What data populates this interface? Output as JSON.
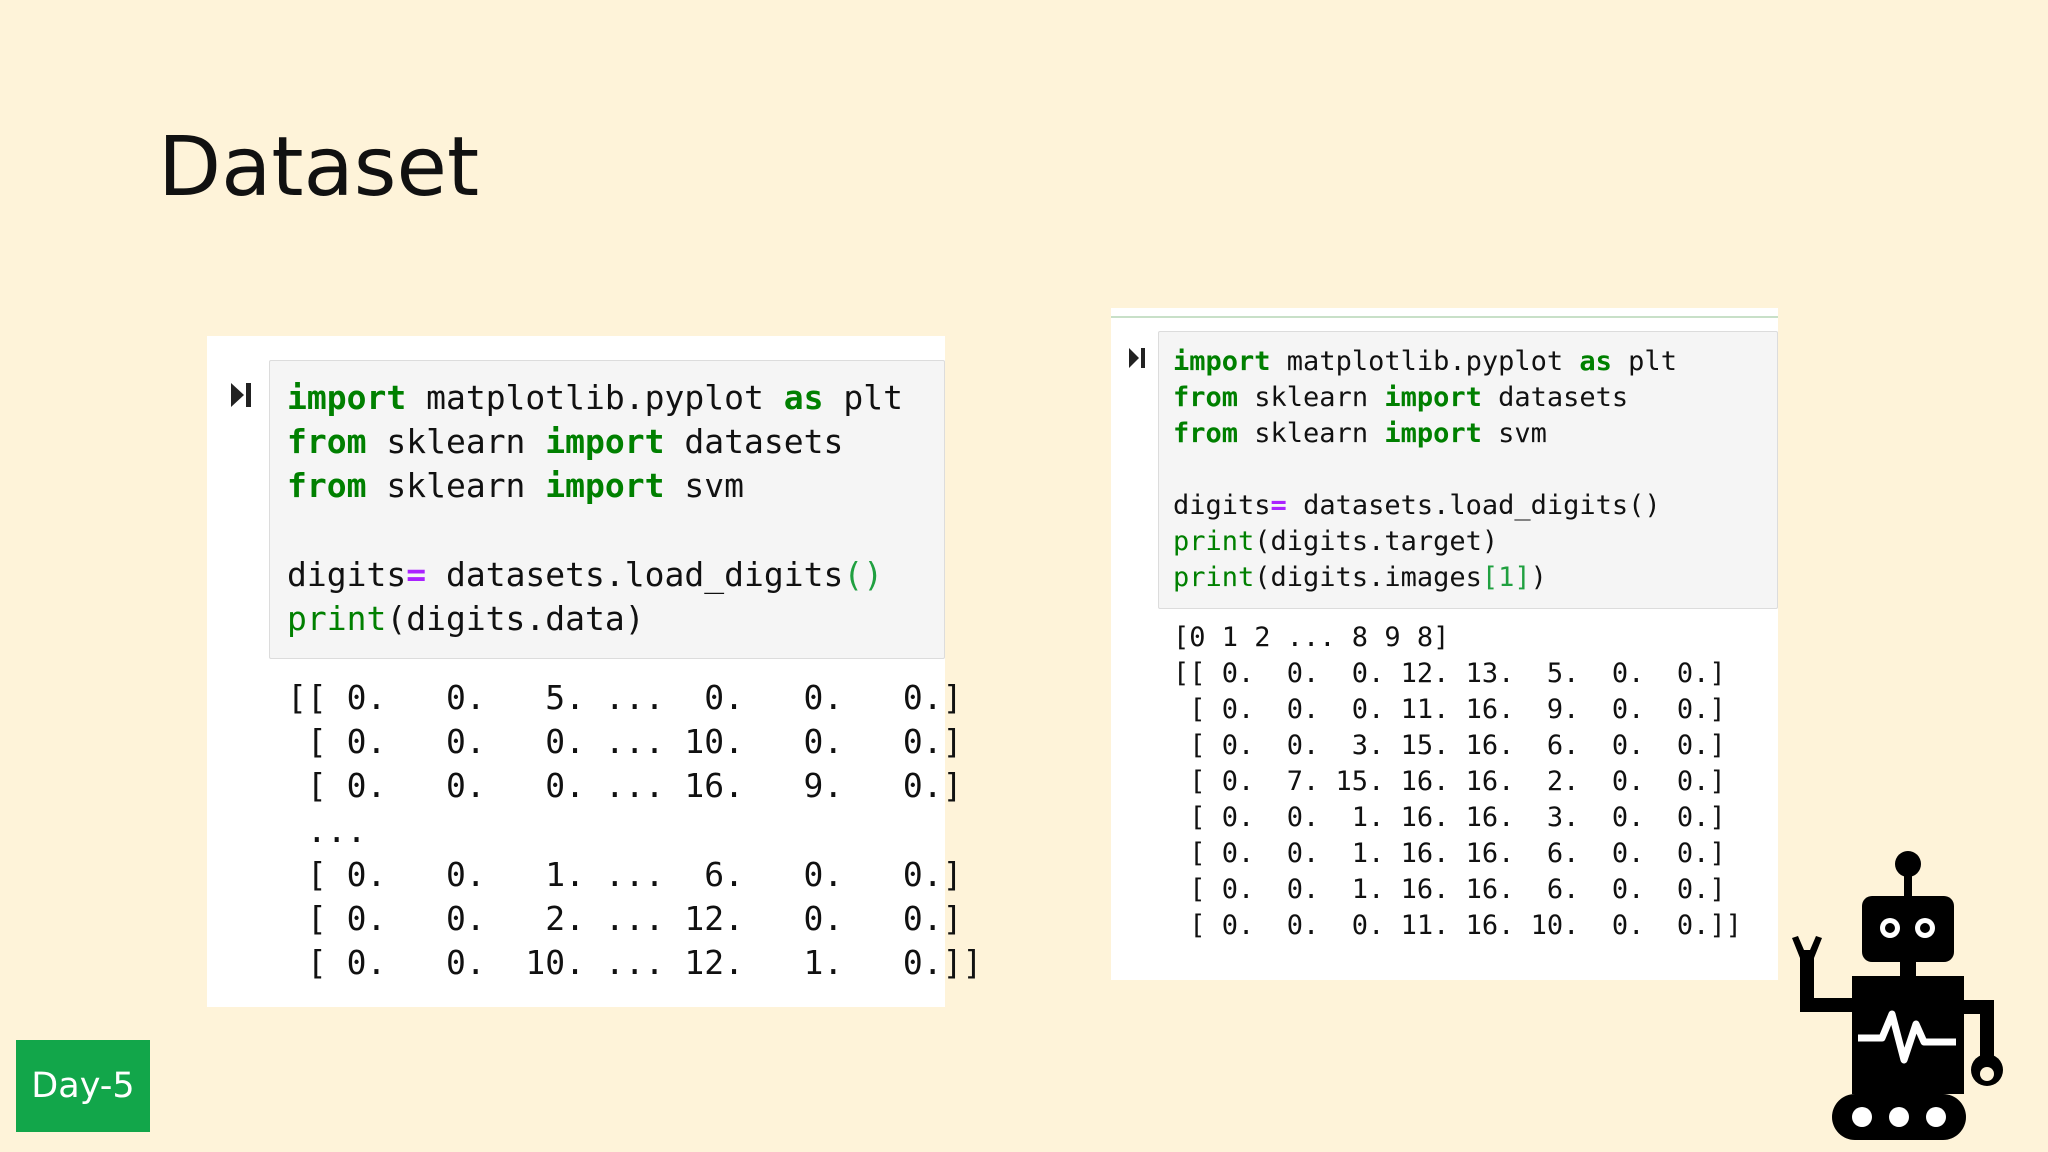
{
  "slide": {
    "title": "Dataset",
    "day_badge": "Day-5",
    "colors": {
      "background": "#fef3d9",
      "badge": "#12a64a",
      "keyword": "#008000",
      "operator": "#aa22ff"
    }
  },
  "left_cell": {
    "code_lines": [
      "import matplotlib.pyplot as plt",
      "from sklearn import datasets",
      "from sklearn import svm",
      "",
      "digits= datasets.load_digits()",
      "print(digits.data)"
    ],
    "output": "[[ 0.   0.   5. ...  0.   0.   0.]\n [ 0.   0.   0. ... 10.   0.   0.]\n [ 0.   0.   0. ... 16.   9.   0.]\n ...\n [ 0.   0.   1. ...  6.   0.   0.]\n [ 0.   0.   2. ... 12.   0.   0.]\n [ 0.   0.  10. ... 12.   1.   0.]]"
  },
  "right_cell": {
    "code_lines": [
      "import matplotlib.pyplot as plt",
      "from sklearn import datasets",
      "from sklearn import svm",
      "",
      "digits= datasets.load_digits()",
      "print(digits.target)",
      "print(digits.images[1])"
    ],
    "output": "[0 1 2 ... 8 9 8]\n[[ 0.  0.  0. 12. 13.  5.  0.  0.]\n [ 0.  0.  0. 11. 16.  9.  0.  0.]\n [ 0.  0.  3. 15. 16.  6.  0.  0.]\n [ 0.  7. 15. 16. 16.  2.  0.  0.]\n [ 0.  0.  1. 16. 16.  3.  0.  0.]\n [ 0.  0.  1. 16. 16.  6.  0.  0.]\n [ 0.  0.  1. 16. 16.  6.  0.  0.]\n [ 0.  0.  0. 11. 16. 10.  0.  0.]]"
  },
  "icons": {
    "run": "run-cell-icon",
    "robot": "robot-icon"
  }
}
